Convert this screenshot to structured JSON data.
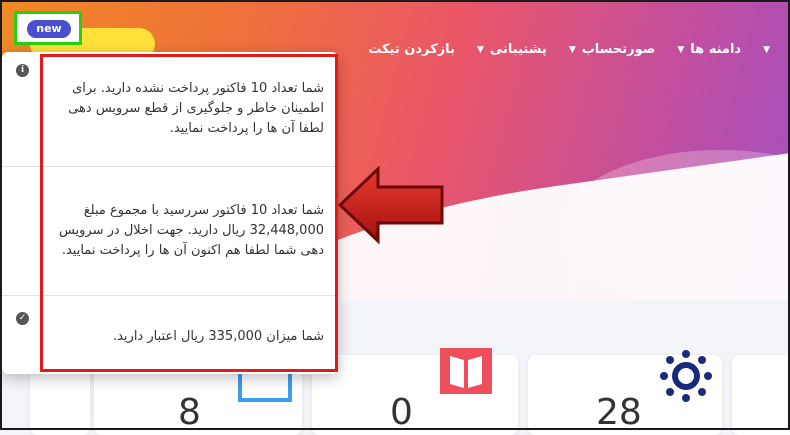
{
  "nav": {
    "items": [
      {
        "label": "",
        "has_caret": true
      },
      {
        "label": "دامنه ها",
        "has_caret": true
      },
      {
        "label": "صورتحساب",
        "has_caret": true
      },
      {
        "label": "پشتیبانی",
        "has_caret": true
      },
      {
        "label": "بازکردن تیکت",
        "has_caret": false
      }
    ]
  },
  "badge": {
    "label": "new"
  },
  "notifications": [
    {
      "icon": "info-icon",
      "text": "شما تعداد 10 فاکتور پرداخت نشده دارید. برای اطمینان خاطر و جلوگیری از قطع سرویس دهی لطفا آن ها را پرداخت نمایید."
    },
    {
      "icon": "",
      "text": "شما تعداد 10 فاکتور سررسید با مجموع مبلغ 32,448,000 ریال دارید. جهت اخلال در سرویس دهی شما لطفا هم اکنون آن ها را پرداخت نمایید."
    },
    {
      "icon": "check-circle-icon",
      "text": "شما میزان 335,000 ریال اعتبار دارید."
    }
  ],
  "stats": [
    {
      "value": "8"
    },
    {
      "value": "0"
    },
    {
      "value": "28"
    }
  ],
  "colors": {
    "accent_box": "#e31a1a",
    "highlight_box": "#26d10e",
    "badge": "#4a4fcf"
  }
}
